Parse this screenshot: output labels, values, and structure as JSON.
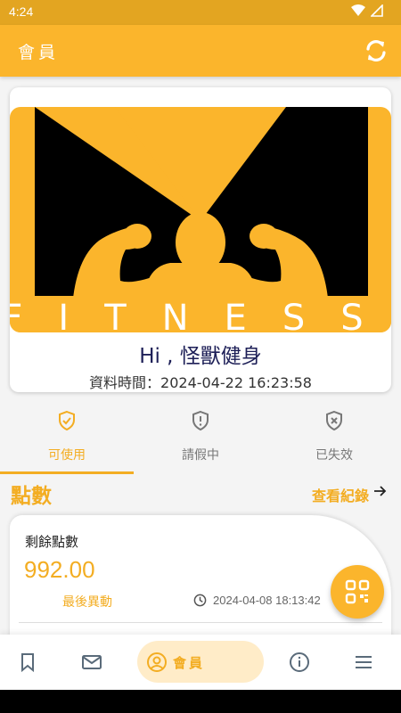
{
  "status_bar": {
    "time": "4:24"
  },
  "app_bar": {
    "title": "會員",
    "refresh_icon": "refresh-icon"
  },
  "member_card": {
    "logo_text": "FITNESS",
    "greeting": "Hi , 怪獸健身",
    "data_time": "資料時間：2024-04-22 16:23:58"
  },
  "tabs": [
    {
      "label": "可使用",
      "icon": "shield-check-icon",
      "active": true
    },
    {
      "label": "請假中",
      "icon": "shield-alert-icon",
      "active": false
    },
    {
      "label": "已失效",
      "icon": "shield-x-icon",
      "active": false
    }
  ],
  "points_section": {
    "title": "點數",
    "view_records": "查看紀錄",
    "remaining_label": "剩餘點數",
    "remaining_value": "992.00",
    "last_change_label": "最後異動",
    "last_change_date": "2024-04-08 18:13:42"
  },
  "bottom_nav": {
    "items": [
      "bookmark-icon",
      "mail-icon",
      "member-icon",
      "info-icon",
      "menu-icon"
    ],
    "active_label": "會員"
  },
  "colors": {
    "brand": "#fbb52c",
    "accent": "#f3ad22",
    "navy": "#1d1f57"
  }
}
